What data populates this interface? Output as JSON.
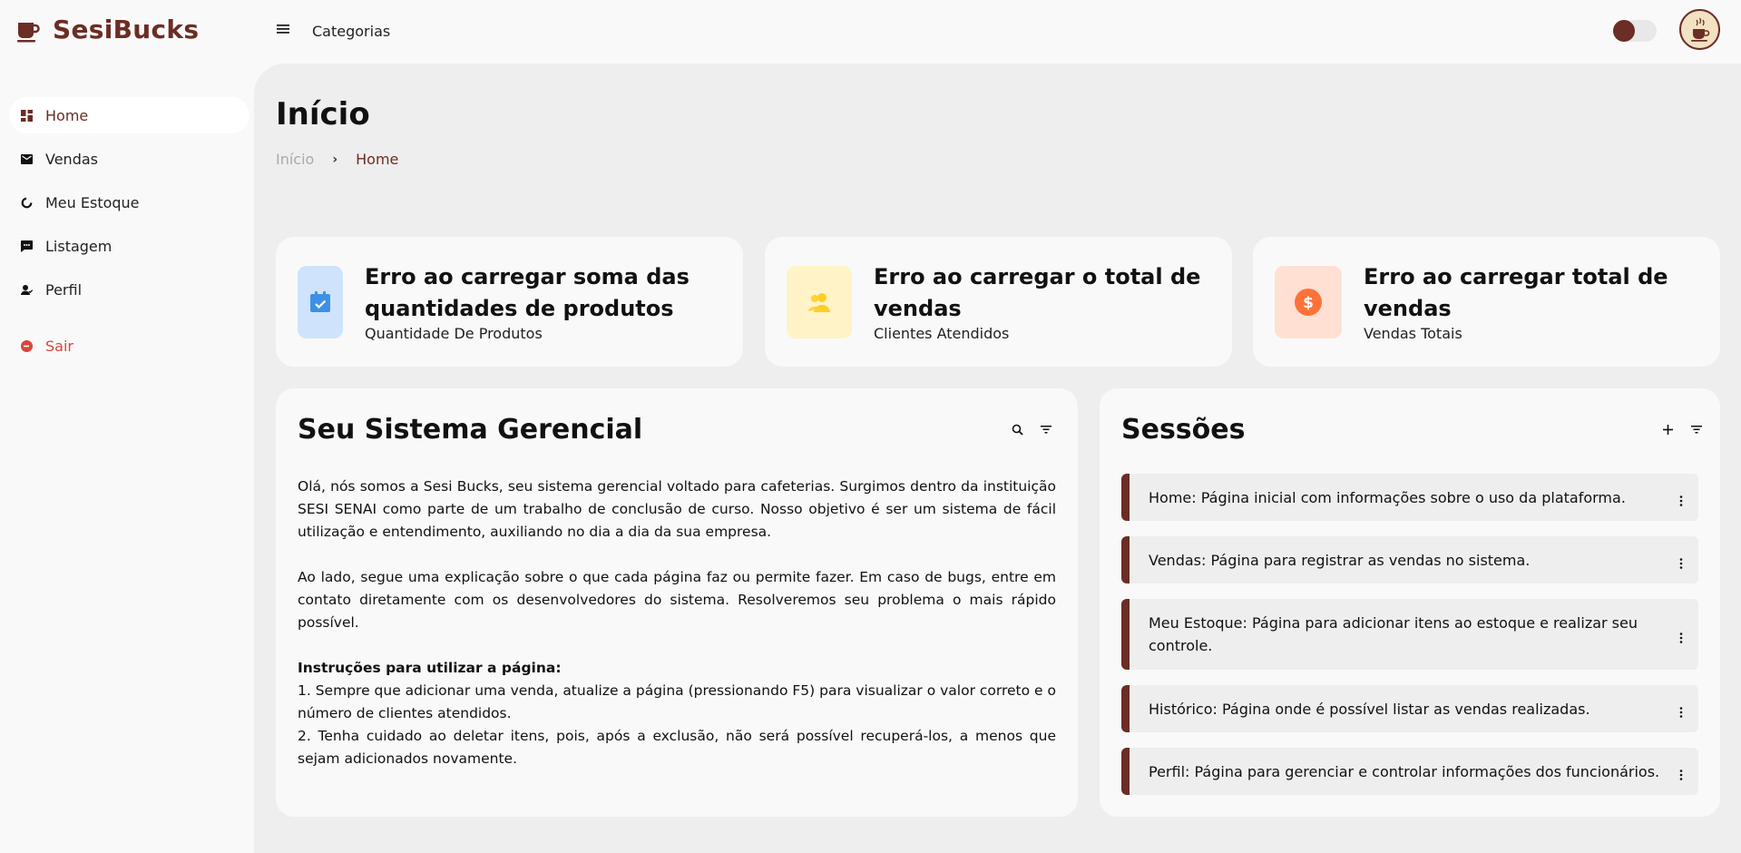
{
  "brand": {
    "name": "SesiBucks",
    "accent": "#6B2D25"
  },
  "topbar": {
    "menu_icon": "menu-icon",
    "link_label": "Categorias"
  },
  "sidebar": {
    "items": [
      {
        "label": "Home",
        "icon": "dashboard-icon",
        "active": true
      },
      {
        "label": "Vendas",
        "icon": "mail-icon"
      },
      {
        "label": "Meu Estoque",
        "icon": "donut-chart-icon"
      },
      {
        "label": "Listagem",
        "icon": "chat-icon"
      },
      {
        "label": "Perfil",
        "icon": "user-icon"
      }
    ],
    "logout": {
      "label": "Sair",
      "icon": "logout-icon",
      "color": "#D9463B"
    }
  },
  "page": {
    "title": "Início",
    "breadcrumb": [
      "Início",
      "Home"
    ]
  },
  "stats": [
    {
      "value": "Erro ao carregar soma das quantidades de produtos",
      "label": "Quantidade De Produtos",
      "icon": "calendar-check-icon",
      "bg": "#CFE3FC",
      "color": "#3C91E6"
    },
    {
      "value": "Erro ao carregar o total de vendas",
      "label": "Clientes Atendidos",
      "icon": "people-icon",
      "bg": "#FFF3C7",
      "color": "#FFCE26"
    },
    {
      "value": "Erro ao carregar total de vendas",
      "label": "Vendas Totais",
      "icon": "dollar-circle-icon",
      "bg": "#FFE0D3",
      "color": "#FD7238"
    }
  ],
  "system_panel": {
    "title": "Seu Sistema Gerencial",
    "paragraphs": [
      "Olá, nós somos a Sesi Bucks, seu sistema gerencial voltado para cafeterias. Surgimos dentro da instituição SESI SENAI como parte de um trabalho de conclusão de curso. Nosso objetivo é ser um sistema de fácil utilização e entendimento, auxiliando no dia a dia da sua empresa.",
      "Ao lado, segue uma explicação sobre o que cada página faz ou permite fazer. Em caso de bugs, entre em contato diretamente com os desenvolvedores do sistema. Resolveremos seu problema o mais rápido possível."
    ],
    "instructions_title": "Instruções para utilizar a página:",
    "instructions": [
      "1. Sempre que adicionar uma venda, atualize a página (pressionando F5) para visualizar o valor correto e o número de clientes atendidos.",
      "2. Tenha cuidado ao deletar itens, pois, após a exclusão, não será possível recuperá-los, a menos que sejam adicionados novamente."
    ]
  },
  "sessions_panel": {
    "title": "Sessões",
    "items": [
      "Home: Página inicial com informações sobre o uso da plataforma.",
      "Vendas: Página para registrar as vendas no sistema.",
      "Meu Estoque: Página para adicionar itens ao estoque e realizar seu controle.",
      "Histórico: Página onde é possível listar as vendas realizadas.",
      "Perfil: Página para gerenciar e controlar informações dos funcionários."
    ]
  }
}
